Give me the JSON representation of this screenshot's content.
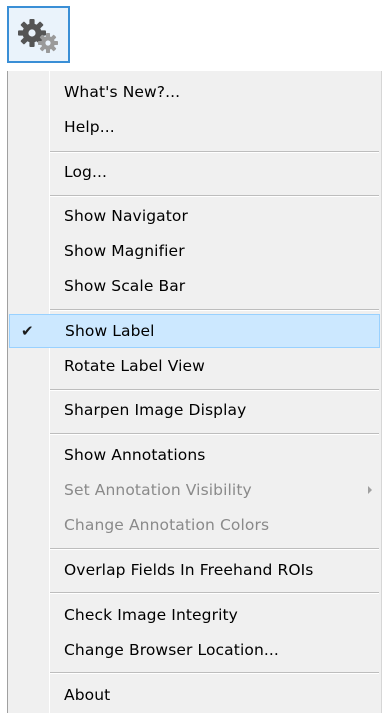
{
  "toolbar": {
    "settings_icon": "gears-icon"
  },
  "menu": {
    "items": [
      {
        "label": "What's New?..."
      },
      {
        "label": "Help..."
      },
      {
        "label": "Log..."
      },
      {
        "label": "Show Navigator"
      },
      {
        "label": "Show Magnifier"
      },
      {
        "label": "Show Scale Bar"
      },
      {
        "label": "Show Label",
        "checked": true,
        "check_glyph": "✔"
      },
      {
        "label": "Rotate Label View"
      },
      {
        "label": "Sharpen Image Display"
      },
      {
        "label": "Show Annotations"
      },
      {
        "label": "Set Annotation Visibility",
        "disabled": true,
        "submenu": true
      },
      {
        "label": "Change Annotation Colors",
        "disabled": true
      },
      {
        "label": "Overlap Fields In Freehand ROIs"
      },
      {
        "label": "Check Image Integrity"
      },
      {
        "label": "Change Browser Location..."
      },
      {
        "label": "About"
      }
    ]
  },
  "colors": {
    "highlight_fill": "#cce8ff",
    "highlight_border": "#99d1ff",
    "button_border": "#3a8fd6",
    "menu_bg": "#f0f0f0",
    "disabled_text": "#8a8a8a"
  }
}
